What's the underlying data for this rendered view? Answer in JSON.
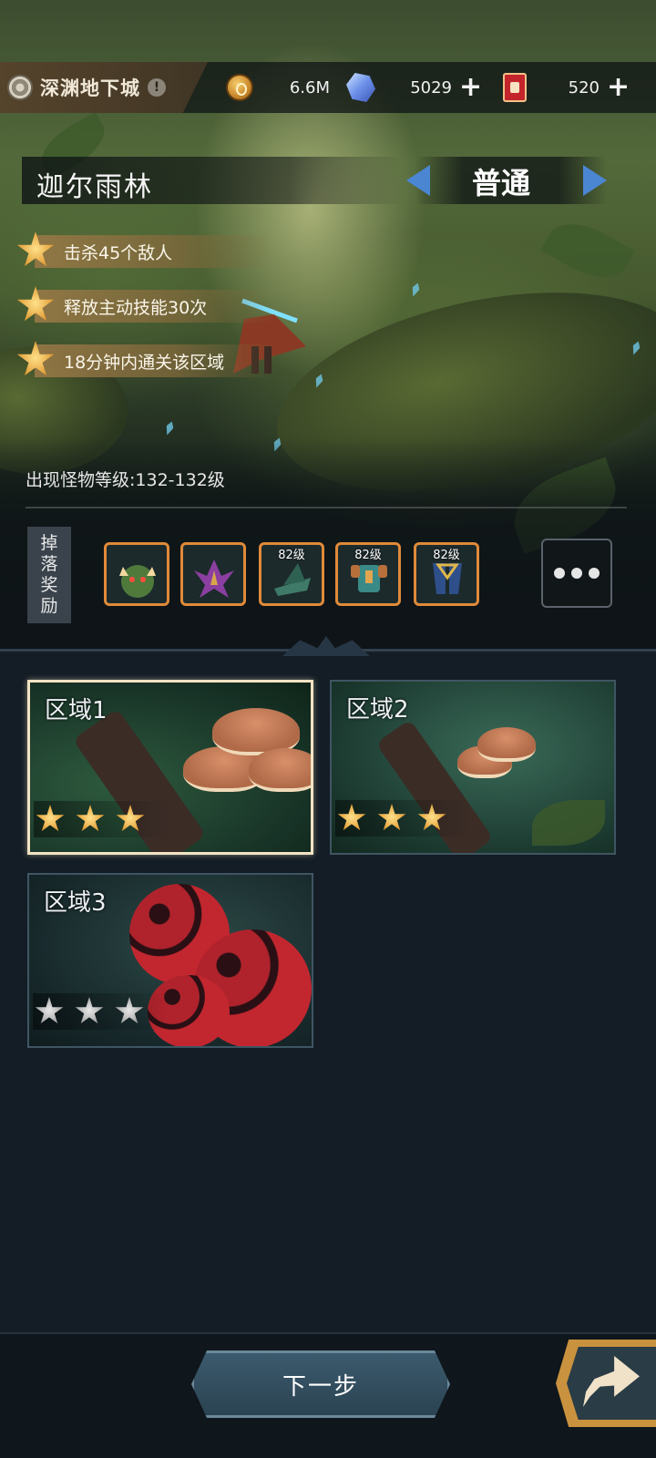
{
  "header": {
    "dungeon_name": "深渊地下城",
    "info_glyph": "!",
    "resources": [
      {
        "icon": "gold-coin-icon",
        "value": "6.6M",
        "has_plus": false
      },
      {
        "icon": "blue-crystal-icon",
        "value": "5029",
        "has_plus": true
      },
      {
        "icon": "red-ticket-icon",
        "value": "520",
        "has_plus": true
      }
    ],
    "plus_glyph": "+"
  },
  "stage": {
    "name": "迦尔雨林",
    "difficulty": "普通"
  },
  "objectives": [
    {
      "text": "击杀45个敌人"
    },
    {
      "text": "释放主动技能30次"
    },
    {
      "text": "18分钟内通关该区域"
    }
  ],
  "monster_level": "出现怪物等级:132-132级",
  "drops": {
    "label": [
      "掉",
      "落",
      "奖",
      "励"
    ],
    "items": [
      {
        "icon": "green-dragon-monster-icon",
        "level": ""
      },
      {
        "icon": "purple-plant-monster-icon",
        "level": ""
      },
      {
        "icon": "green-hat-icon",
        "level": "82级"
      },
      {
        "icon": "armor-chest-icon",
        "level": "82级"
      },
      {
        "icon": "blue-boots-icon",
        "level": "82级"
      }
    ]
  },
  "zones": [
    {
      "title": "区域1",
      "stars": 3,
      "max_stars": 3,
      "selected": true
    },
    {
      "title": "区域2",
      "stars": 3,
      "max_stars": 3,
      "selected": false
    },
    {
      "title": "区域3",
      "stars": 0,
      "max_stars": 3,
      "selected": false
    }
  ],
  "footer": {
    "next_label": "下一步"
  },
  "colors": {
    "accent_gold": "#e3a13a",
    "reward_border": "#e08a3a",
    "arrow_blue": "#4b86d2",
    "background": "#141d25"
  }
}
